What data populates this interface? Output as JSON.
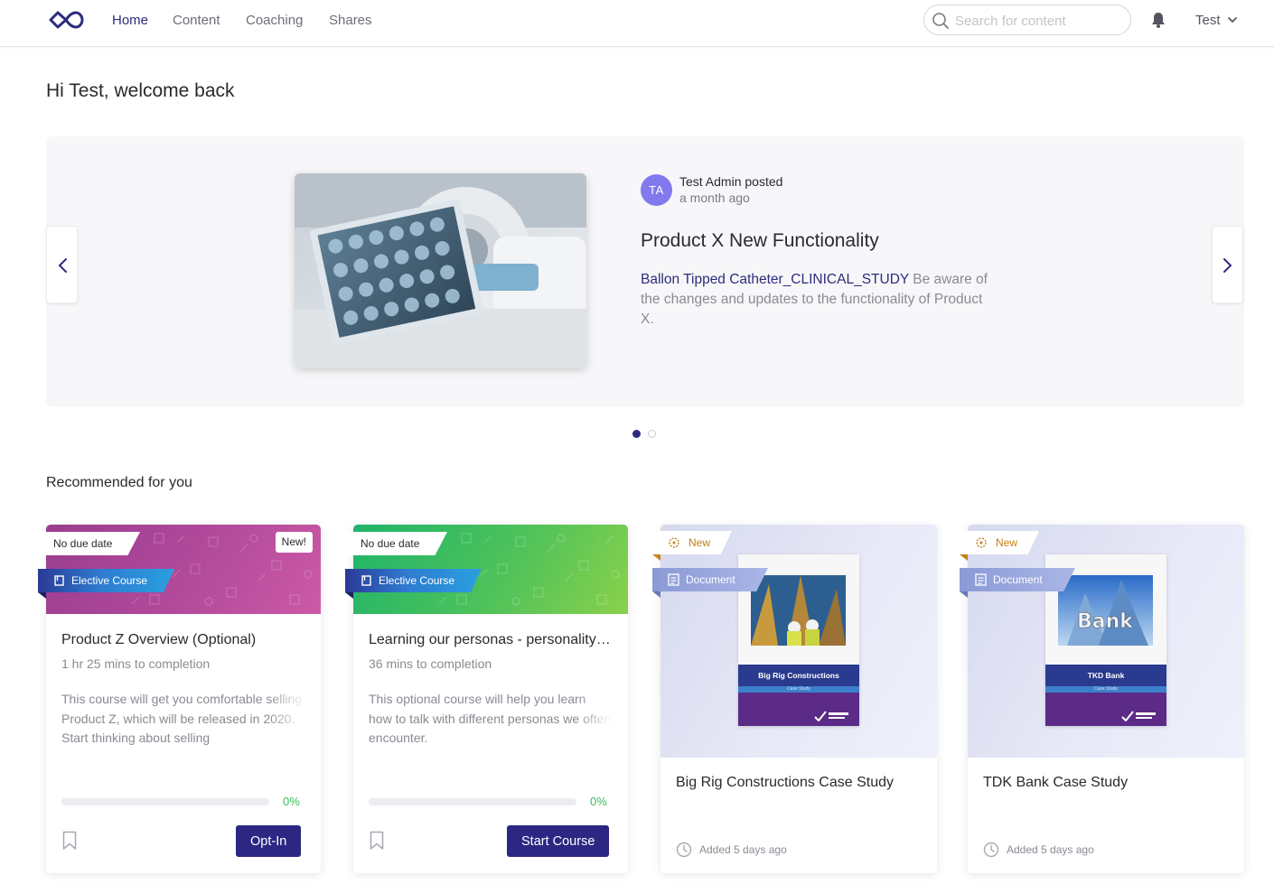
{
  "nav": {
    "links": [
      "Home",
      "Content",
      "Coaching",
      "Shares"
    ],
    "active_link": "Home",
    "search_placeholder": "Search for content",
    "user_name": "Test"
  },
  "greeting": "Hi Test, welcome back",
  "carousel": {
    "author_initials": "TA",
    "poster": "Test Admin posted",
    "posted_time": "a month ago",
    "title": "Product X New Functionality",
    "link_text": "Ballon Tipped Catheter_CLINICAL_STUDY",
    "description": " Be aware of the changes and updates to the functionality of Product X.",
    "slide_count": 2,
    "active_slide": 1
  },
  "recommended": {
    "title": "Recommended for you",
    "courses": [
      {
        "due": "No due date",
        "type": "Elective Course",
        "new_tag": "New!",
        "title": "Product Z Overview (Optional)",
        "duration": "1 hr 25 mins to completion",
        "description": "This course will get you comfortable selling Product Z, which will be released in 2020. Start thinking about selling",
        "progress": 0,
        "progress_label": "0%",
        "action": "Opt-In"
      },
      {
        "due": "No due date",
        "type": "Elective Course",
        "title": "Learning our personas - personality types",
        "duration": "36 mins to completion",
        "description": "This optional course will help you learn how to talk with different personas we often encounter.",
        "progress": 0,
        "progress_label": "0%",
        "action": "Start Course"
      }
    ],
    "documents": [
      {
        "new_label": "New",
        "type": "Document",
        "cover_title": "Big Rig Constructions",
        "cover_subtitle": "Case Study",
        "title": "Big Rig Constructions Case Study",
        "added": "Added 5 days ago"
      },
      {
        "new_label": "New",
        "type": "Document",
        "cover_title": "TKD Bank",
        "cover_subtitle": "Case Study",
        "title": "TDK Bank Case Study",
        "added": "Added 5 days ago"
      }
    ]
  },
  "colors": {
    "brand": "#2e2c7d",
    "button": "#2b2783",
    "progress": "#3cbd5b",
    "avatar": "#8379ef",
    "new_accent": "#c38214"
  }
}
